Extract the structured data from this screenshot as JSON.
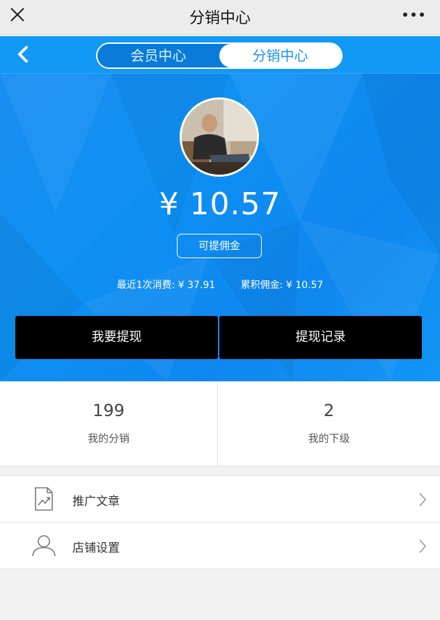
{
  "topbar": {
    "title": "分销中心"
  },
  "nav": {
    "tabs": [
      {
        "label": "会员中心"
      },
      {
        "label": "分销中心"
      }
    ],
    "active_tab": "分销中心"
  },
  "hero": {
    "balance": "¥ 10.57",
    "balance_label": "可提佣金",
    "last_spend": "最近1次消费: ¥ 37.91",
    "total_commission": "累积佣金: ¥ 10.57"
  },
  "actions": {
    "withdraw": "我要提现",
    "withdraw_history": "提现记录"
  },
  "counters": [
    {
      "value": "199",
      "label": "我的分销"
    },
    {
      "value": "2",
      "label": "我的下级"
    }
  ],
  "menu": [
    {
      "label": "推广文章",
      "icon": "document-chart-icon"
    },
    {
      "label": "店铺设置",
      "icon": "user-icon"
    }
  ],
  "colors": {
    "primary_blue": "#1296f5",
    "button_bg": "#000000",
    "page_bg": "#f2f2f2"
  }
}
